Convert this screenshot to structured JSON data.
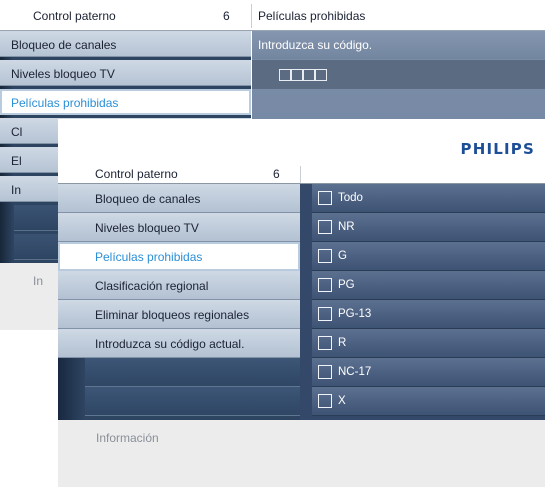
{
  "back_screen": {
    "header": {
      "title": "Control paterno",
      "number": "6",
      "submenu_title": "Películas prohibidas"
    },
    "menu_items": [
      {
        "label": "Bloqueo de canales"
      },
      {
        "label": "Niveles bloqueo TV"
      },
      {
        "label": "Películas prohibidas",
        "selected": true
      },
      {
        "label": "Cl"
      },
      {
        "label": "El"
      },
      {
        "label": "In"
      }
    ],
    "prompt": "Introduzca su código.",
    "code_slots": 4,
    "info_label": "In"
  },
  "front_screen": {
    "brand": "PHILIPS",
    "header": {
      "title": "Control paterno",
      "number": "6"
    },
    "menu_items": [
      {
        "label": "Bloqueo de canales"
      },
      {
        "label": "Niveles bloqueo TV"
      },
      {
        "label": "Películas prohibidas",
        "selected": true
      },
      {
        "label": "Clasificación regional"
      },
      {
        "label": "Eliminar bloqueos regionales"
      },
      {
        "label": "Introduzca su código actual."
      },
      {
        "label": ""
      },
      {
        "label": ""
      }
    ],
    "options": [
      {
        "label": "Todo",
        "checked": false
      },
      {
        "label": "NR",
        "checked": false
      },
      {
        "label": "G",
        "checked": false
      },
      {
        "label": "PG",
        "checked": false
      },
      {
        "label": "PG-13",
        "checked": false
      },
      {
        "label": "R",
        "checked": false
      },
      {
        "label": "NC-17",
        "checked": false
      },
      {
        "label": "X",
        "checked": false
      }
    ],
    "info_label": "Información"
  },
  "colors": {
    "brand_blue": "#1d4f96",
    "highlight_text": "#2b8fd6",
    "panel_dark": "#2e4562",
    "menu_light": "#cfd9e5"
  }
}
